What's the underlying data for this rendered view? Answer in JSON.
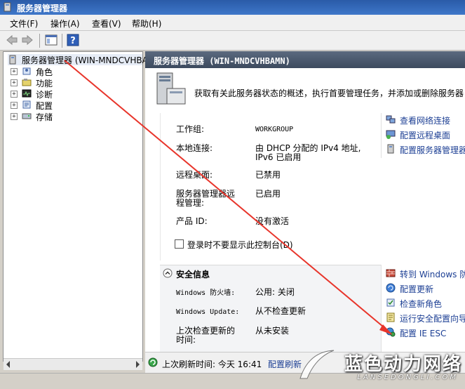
{
  "window": {
    "title": "服务器管理器"
  },
  "menu": [
    {
      "label": "文件(F)"
    },
    {
      "label": "操作(A)"
    },
    {
      "label": "查看(V)"
    },
    {
      "label": "帮助(H)"
    }
  ],
  "tree": {
    "root": "服务器管理器 (WIN-MNDCVHBAMN",
    "items": [
      {
        "label": "角色"
      },
      {
        "label": "功能"
      },
      {
        "label": "诊断"
      },
      {
        "label": "配置"
      },
      {
        "label": "存储"
      }
    ]
  },
  "main": {
    "header": "服务器管理器 (WIN-MNDCVHBAMN)",
    "summary": "获取有关此服务器状态的概述，执行首要管理任务，并添加或删除服务器",
    "computer_info": [
      {
        "label": "工作组:",
        "value": "WORKGROUP"
      },
      {
        "label": "本地连接:",
        "value": "由 DHCP 分配的 IPv4 地址, IPv6 已启用"
      },
      {
        "label": "远程桌面:",
        "value": "已禁用"
      },
      {
        "label": "服务器管理器远程管理:",
        "value": "已启用"
      },
      {
        "label": "产品 ID:",
        "value": "没有激活"
      }
    ],
    "show_at_logon_checkbox": "登录时不要显示此控制台(D)",
    "computer_actions": [
      {
        "label": "查看网络连接",
        "icon": "network-icon"
      },
      {
        "label": "配置远程桌面",
        "icon": "remote-desktop-icon"
      },
      {
        "label": "配置服务器管理器",
        "icon": "server-manager-icon"
      }
    ],
    "security": {
      "title": "安全信息",
      "rows": [
        {
          "label": "Windows 防火墙:",
          "value": "公用: 关闭"
        },
        {
          "label": "Windows Update:",
          "value": "从不检查更新"
        },
        {
          "label": "上次检查更新的时间:",
          "value": "从未安装"
        }
      ],
      "actions": [
        {
          "label": "转到 Windows 防",
          "icon": "firewall-icon"
        },
        {
          "label": "配置更新",
          "icon": "update-icon"
        },
        {
          "label": "检查新角色",
          "icon": "check-roles-icon"
        },
        {
          "label": "运行安全配置向导",
          "icon": "security-wizard-icon"
        },
        {
          "label": "配置 IE ESC",
          "icon": "ie-esc-icon"
        }
      ]
    },
    "status": {
      "last_refresh_label": "上次刷新时间: 今天 16:41",
      "refresh_link": "配置刷新"
    }
  },
  "watermark": {
    "brand": "蓝色动力网络",
    "domain": "LANSEDONGLI.COM"
  },
  "colors": {
    "link": "#1c3f94",
    "arrow": "#e8352b",
    "header": "#3c4a5e"
  }
}
